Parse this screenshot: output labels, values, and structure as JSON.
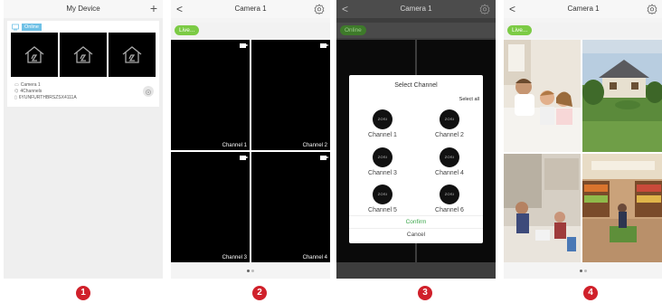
{
  "screen1": {
    "title": "My Device",
    "plus": "+",
    "status": "Online",
    "device_name": "Camera 1",
    "channels": "4Channels",
    "id": "6YUNFURTHBRSZSX4111A",
    "step": "1"
  },
  "screen2": {
    "title": "Camera 1",
    "back": "<",
    "live": "Live...",
    "channels": [
      "Channel 1",
      "Channel 2",
      "Channel 3",
      "Channel 4"
    ],
    "step": "2"
  },
  "screen3": {
    "title": "Camera 1",
    "back": "<",
    "status": "Online",
    "dialog_title": "Select Channel",
    "select_all": "Select all",
    "brand": "ZOSI",
    "channels": [
      "Channel 1",
      "Channel 2",
      "Channel 3",
      "Channel 4",
      "Channel 5",
      "Channel 6"
    ],
    "confirm": "Confirm",
    "cancel": "Cancel",
    "step": "3"
  },
  "screen4": {
    "title": "Camera 1",
    "back": "<",
    "live": "Live...",
    "step": "4"
  },
  "colors": {
    "accent_green": "#7ccb45",
    "step_red": "#d0202a",
    "online_blue": "#6fc1e6"
  }
}
